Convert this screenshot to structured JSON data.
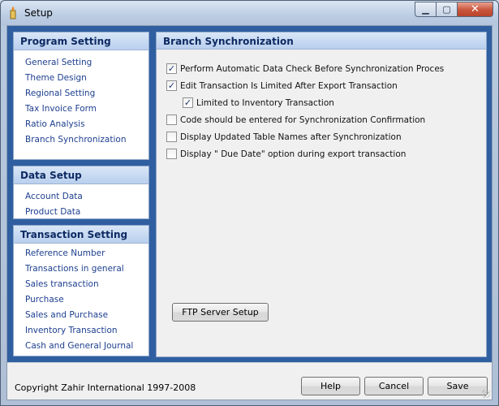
{
  "window": {
    "title": "Setup",
    "min_symbol": "▁",
    "max_symbol": "▢",
    "close_symbol": "✕"
  },
  "sidebar": {
    "groups": [
      {
        "title": "Program Setting",
        "items": [
          "General Setting",
          "Theme Design",
          "Regional Setting",
          "Tax Invoice Form",
          "Ratio Analysis",
          "Branch Synchronization"
        ]
      },
      {
        "title": "Data Setup",
        "items": [
          "Account Data",
          "Product Data"
        ]
      },
      {
        "title": "Transaction Setting",
        "items": [
          "Reference Number",
          "Transactions in general",
          "Sales transaction",
          "Purchase",
          "Sales and Purchase",
          "Inventory Transaction",
          "Cash and General Journal"
        ]
      }
    ]
  },
  "panel": {
    "title": "Branch Synchronization",
    "options": [
      {
        "label": "Perform Automatic Data Check Before Synchronization Proces",
        "checked": true
      },
      {
        "label": "Edit Transaction Is Limited After Export Transaction",
        "checked": true
      },
      {
        "label": "Limited to Inventory Transaction",
        "checked": true
      },
      {
        "label": "Code should be entered for Synchronization Confirmation",
        "checked": false
      },
      {
        "label": "Display Updated Table Names after Synchronization",
        "checked": false
      },
      {
        "label": "Display \" Due Date\" option during export transaction",
        "checked": false
      }
    ],
    "ftp_button": "FTP Server Setup"
  },
  "footer": {
    "copyright": "Copyright Zahir International 1997-2008",
    "help": "Help",
    "cancel": "Cancel",
    "save": "Save"
  },
  "icons": {
    "app": "candle-icon",
    "check": "✓"
  },
  "colors": {
    "sidebar_bg": "#2f5fa0",
    "header_text": "#0d2a62",
    "link_text": "#1d3f8f"
  }
}
